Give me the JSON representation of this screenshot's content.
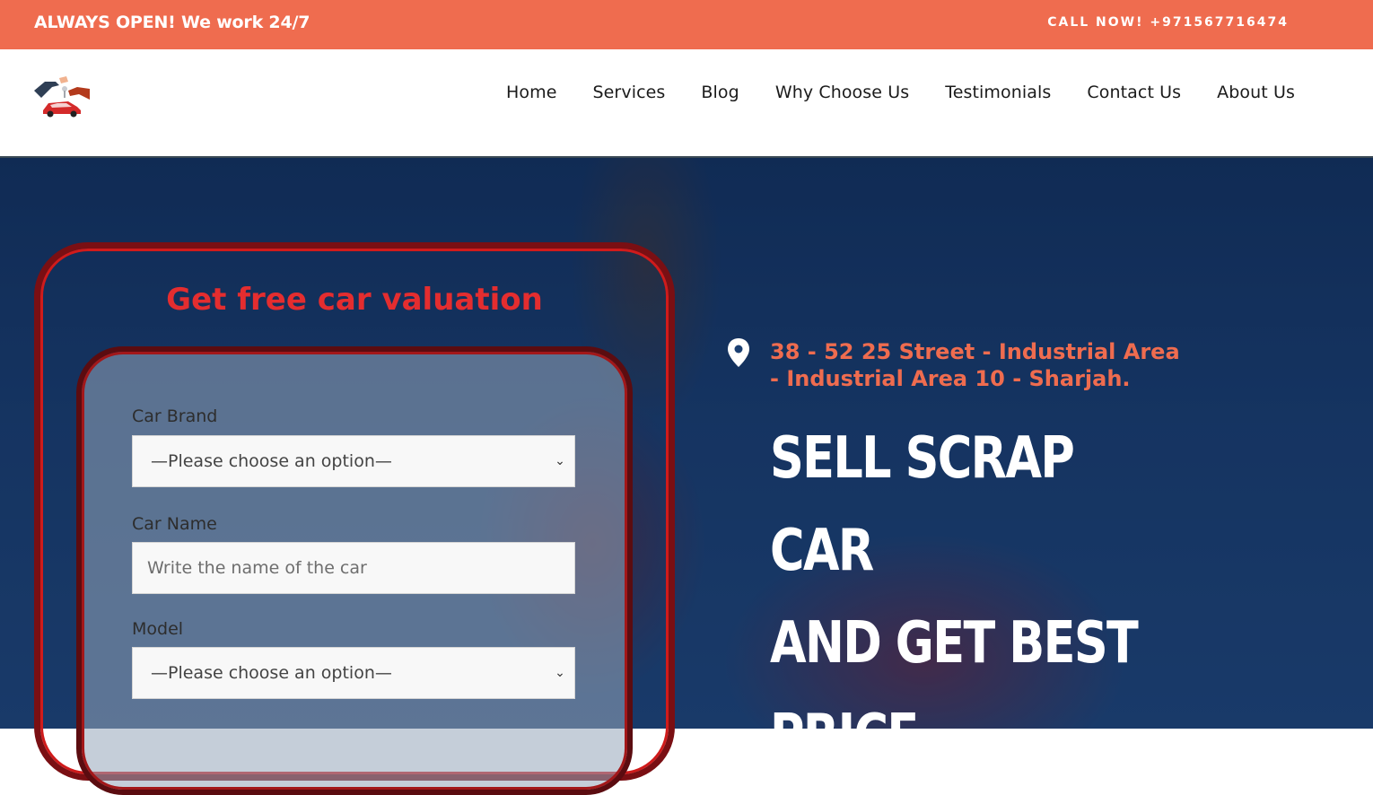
{
  "topbar": {
    "left_text": "ALWAYS OPEN! We work 24/7",
    "right_text": "CALL NOW! +971567716474",
    "bg_color": "#ef6c4f"
  },
  "header": {
    "logo_icon": "car-key-handover-logo",
    "nav": [
      {
        "label": "Home"
      },
      {
        "label": "Services"
      },
      {
        "label": "Blog"
      },
      {
        "label": "Why Choose Us"
      },
      {
        "label": "Testimonials"
      },
      {
        "label": "Contact Us"
      },
      {
        "label": "About Us"
      }
    ]
  },
  "hero": {
    "valuation": {
      "title": "Get free car valuation",
      "title_color": "#e42d2f",
      "fields": [
        {
          "label": "Car Brand",
          "type": "select",
          "value": "—Please choose an option—"
        },
        {
          "label": "Car Name",
          "type": "input",
          "placeholder": "Write the name of the car"
        },
        {
          "label": "Model",
          "type": "select",
          "value": "—Please choose an option—"
        }
      ]
    },
    "address_icon": "location-pin-icon",
    "address": "38 - 52 25 Street - Industrial Area - Industrial Area 10 - Sharjah.",
    "address_color": "#ef6c4f",
    "headline_lines": [
      "Sell Scrap Car",
      "and get best",
      "price."
    ]
  }
}
